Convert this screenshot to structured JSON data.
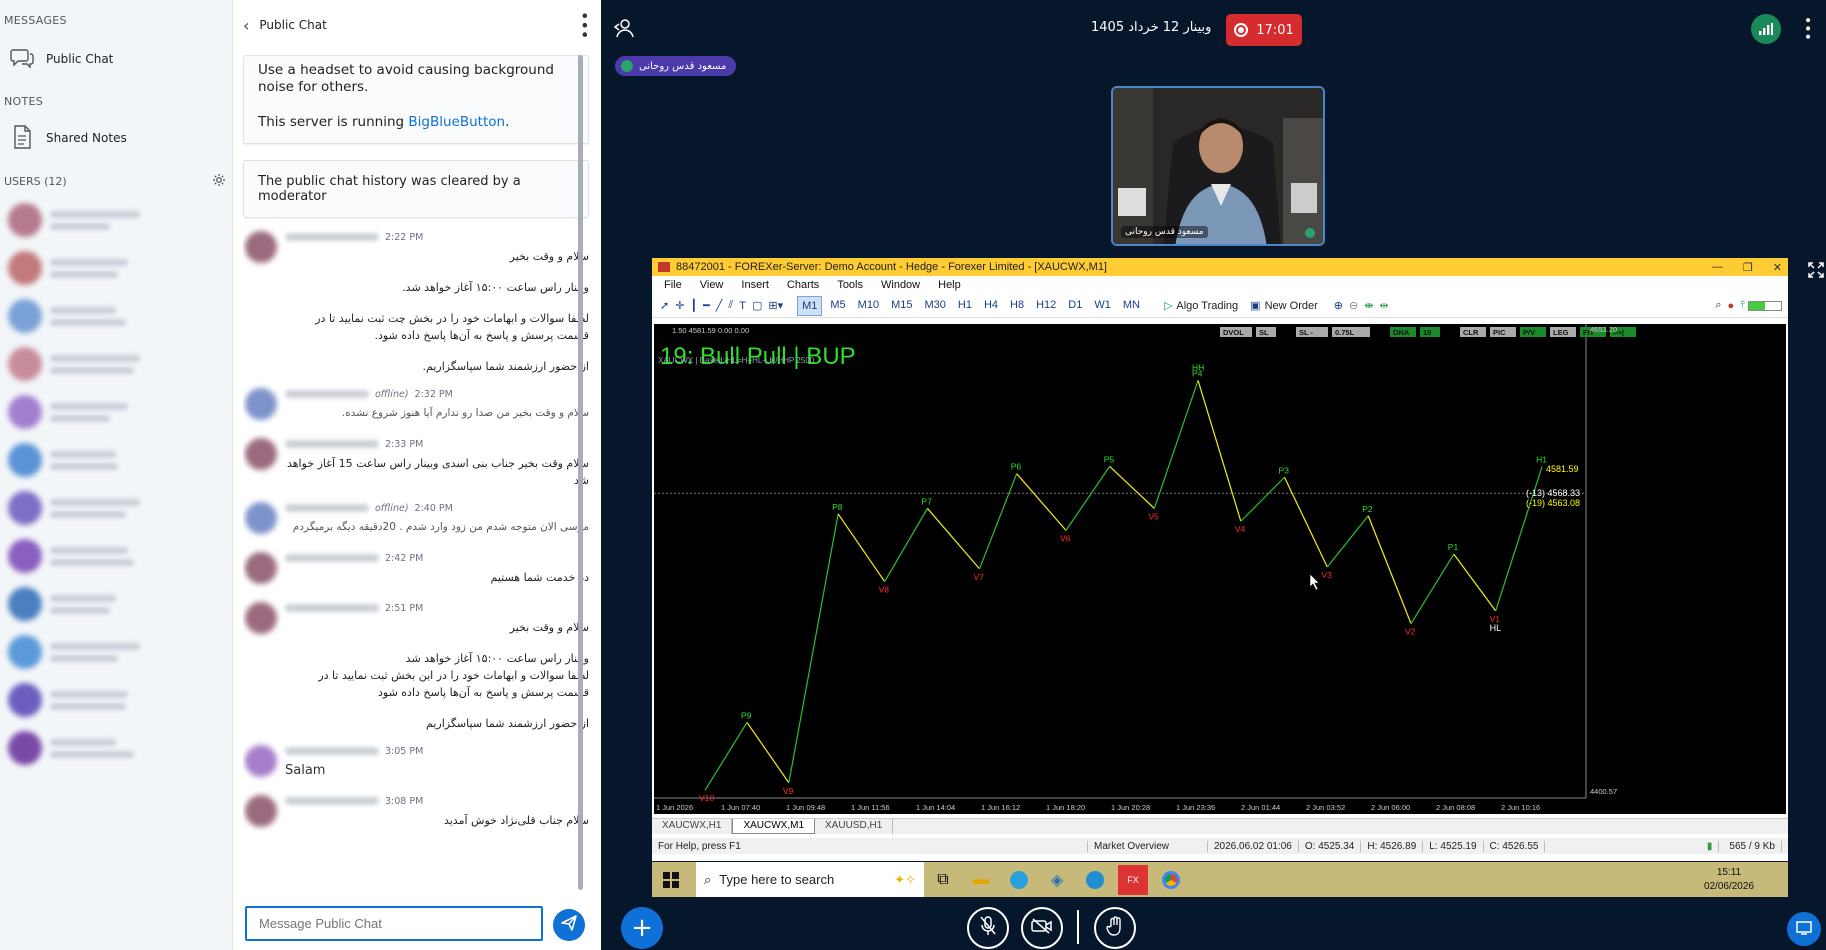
{
  "sidebar": {
    "messages_title": "MESSAGES",
    "public_chat": "Public Chat",
    "notes_title": "NOTES",
    "shared_notes": "Shared Notes",
    "users_title": "USERS (12)",
    "user_colors": [
      "#b67a8e",
      "#c27a7a",
      "#7aa2d6",
      "#c78c9a",
      "#a47fd0",
      "#5a93d6",
      "#7d6fc6",
      "#8a5fc0",
      "#4a7fc0",
      "#5b9ad9",
      "#6b5ec0",
      "#7a4aa8"
    ]
  },
  "chat": {
    "header": "Public Chat",
    "welcome_line1": "Use a headset to avoid causing background noise for others.",
    "welcome_line2_prefix": "This server is running ",
    "welcome_link": "BigBlueButton",
    "welcome_line2_suffix": ".",
    "cleared": "The public chat history was cleared by a moderator",
    "messages": [
      {
        "time": "2:22 PM",
        "avatar": "#9b6a7e",
        "lines": [
          "سلام و وقت بخیر",
          "وبینار راس ساعت ۱۵:۰۰ آغاز خواهد شد.",
          "لطفا سوالات و ابهامات خود را در بخش چت ثبت نمایید تا در قسمت پرسش و پاسخ به آن‌ها پاسخ داده شود.",
          "از حضور ارزشمند شما سپاسگزاریم."
        ]
      },
      {
        "time": "2:32 PM",
        "offline": "offline)",
        "avatar": "#7e92cc",
        "lines": [
          "سلام و وقت بخیر من صدا رو ندارم آیا هنوز شروع نشده."
        ]
      },
      {
        "time": "2:33 PM",
        "avatar": "#9b6a7e",
        "lines": [
          "سلام وقت بخیر جناب بنی اسدی وبینار راس ساعت 15 آغاز خواهد شد"
        ]
      },
      {
        "time": "2:40 PM",
        "offline": "offline)",
        "avatar": "#7e92cc",
        "lines": [
          "مرسی الان متوجه شدم من زود وارد شدم . 20دقیقه دیگه برمیگردم"
        ]
      },
      {
        "time": "2:42 PM",
        "avatar": "#9b6a7e",
        "lines": [
          "در خدمت شما هستیم"
        ]
      },
      {
        "time": "2:51 PM",
        "avatar": "#9b6a7e",
        "lines": [
          "سلام و وقت بخیر",
          "وبینار راس ساعت ۱۵:۰۰ آغاز خواهد شد\nلطفا سوالات و ابهامات خود را در این بخش ثبت نمایید تا در قسمت پرسش و پاسخ به آن‌ها پاسخ داده شود",
          "از حضور ارزشمند شما سپاسگزاریم"
        ]
      },
      {
        "time": "3:05 PM",
        "avatar": "#a67ec9",
        "ltr": true,
        "lines": [
          "Salam"
        ]
      },
      {
        "time": "3:08 PM",
        "avatar": "#9b6a7e",
        "lines": [
          "سلام جناب قلی‌نژاد خوش آمدید"
        ]
      }
    ],
    "input_placeholder": "Message Public Chat"
  },
  "presentation": {
    "title": "وبینار 12 خرداد 1405",
    "recording_time": "17:01",
    "talker": "مسعود قدس روحانی",
    "webcam_name": "مسعود قدس روحانی"
  },
  "mt": {
    "window_title": "88472001 - FOREXer-Server: Demo Account - Hedge - Forexer Limited - [XAUCWX,M1]",
    "menu": [
      "File",
      "View",
      "Insert",
      "Charts",
      "Tools",
      "Window",
      "Help"
    ],
    "timeframes": [
      "M1",
      "M5",
      "M10",
      "M15",
      "M30",
      "H1",
      "H4",
      "H8",
      "H12",
      "D1",
      "W1",
      "MN"
    ],
    "active_tf": "M1",
    "algo_trading": "Algo Trading",
    "new_order": "New Order",
    "chart_info": "1.50 4581.59 0.00 0.00",
    "indicator_line": "XAUCWX | Based: HL=H+HL-LH/HHP 2500",
    "overlay_title": "19:  Bull Pull | BUP",
    "top_buttons": [
      "DVOL",
      "SL",
      "SL -",
      "0.75L",
      "DNA",
      "19",
      "CLR",
      "PIC",
      "P/V",
      "LEG",
      "FIT",
      ">>|"
    ],
    "price_labels": [
      {
        "text": "4581.59",
        "color": "#ffff00"
      },
      {
        "text": "(-13)  4568.33",
        "color": "#ffffff"
      },
      {
        "text": "(-19)  4563.08",
        "color": "#ffff00"
      }
    ],
    "scale_top": "4653.20",
    "scale_bottom": "4400.57",
    "time_labels": [
      "1 Jun 2026",
      "1 Jun 07:40",
      "1 Jun 09:48",
      "1 Jun 11:56",
      "1 Jun 14:04",
      "1 Jun 16:12",
      "1 Jun 18:20",
      "1 Jun 20:28",
      "1 Jun 23:36",
      "2 Jun 01:44",
      "2 Jun 03:52",
      "2 Jun 06:00",
      "2 Jun 08:08",
      "2 Jun 10:16"
    ],
    "tabs": [
      "XAUCWX,H1",
      "XAUCWX,M1",
      "XAUUSD,H1"
    ],
    "active_tab": "XAUCWX,M1",
    "status": {
      "help": "For Help, press F1",
      "overview": "Market Overview",
      "datetime": "2026.06.02 01:06",
      "open": "O: 4525.34",
      "high": "H: 4526.89",
      "low": "L: 4525.19",
      "close": "C: 4526.55",
      "traffic": "565 / 9 Kb"
    }
  },
  "chart_data": {
    "type": "line",
    "title": "19:  Bull Pull | BUP",
    "xlabel": "",
    "ylabel": "",
    "ylim": [
      4400.57,
      4653.2
    ],
    "swing_points": [
      {
        "label": "V10",
        "t": 0.055,
        "price": 4406,
        "kind": "valley"
      },
      {
        "label": "P9",
        "t": 0.1,
        "price": 4443,
        "kind": "peak"
      },
      {
        "label": "V9",
        "t": 0.145,
        "price": 4410,
        "kind": "valley"
      },
      {
        "label": "P8",
        "t": 0.198,
        "price": 4557,
        "kind": "peak"
      },
      {
        "label": "V8",
        "t": 0.248,
        "price": 4520,
        "kind": "valley"
      },
      {
        "label": "P7",
        "t": 0.294,
        "price": 4560,
        "kind": "peak"
      },
      {
        "label": "V7",
        "t": 0.35,
        "price": 4527,
        "kind": "valley"
      },
      {
        "label": "P6",
        "t": 0.39,
        "price": 4579,
        "kind": "peak"
      },
      {
        "label": "V6",
        "t": 0.443,
        "price": 4548,
        "kind": "valley"
      },
      {
        "label": "P5",
        "t": 0.49,
        "price": 4583,
        "kind": "peak"
      },
      {
        "label": "V5",
        "t": 0.538,
        "price": 4560,
        "kind": "valley"
      },
      {
        "label": "P4",
        "t": 0.585,
        "price": 4630,
        "kind": "peak"
      },
      {
        "label": "V4",
        "t": 0.631,
        "price": 4553,
        "kind": "valley"
      },
      {
        "label": "P3",
        "t": 0.678,
        "price": 4577,
        "kind": "peak"
      },
      {
        "label": "V3",
        "t": 0.724,
        "price": 4528,
        "kind": "valley"
      },
      {
        "label": "P2",
        "t": 0.768,
        "price": 4556,
        "kind": "peak"
      },
      {
        "label": "V2",
        "t": 0.814,
        "price": 4497,
        "kind": "valley"
      },
      {
        "label": "P1",
        "t": 0.86,
        "price": 4535,
        "kind": "peak"
      },
      {
        "label": "V1",
        "t": 0.905,
        "price": 4504,
        "kind": "valley"
      },
      {
        "label": "H1",
        "t": 0.955,
        "price": 4583,
        "kind": "peak"
      }
    ],
    "top_label": "HH",
    "hl_label": "HL",
    "ref_price": 4568.33
  }
}
